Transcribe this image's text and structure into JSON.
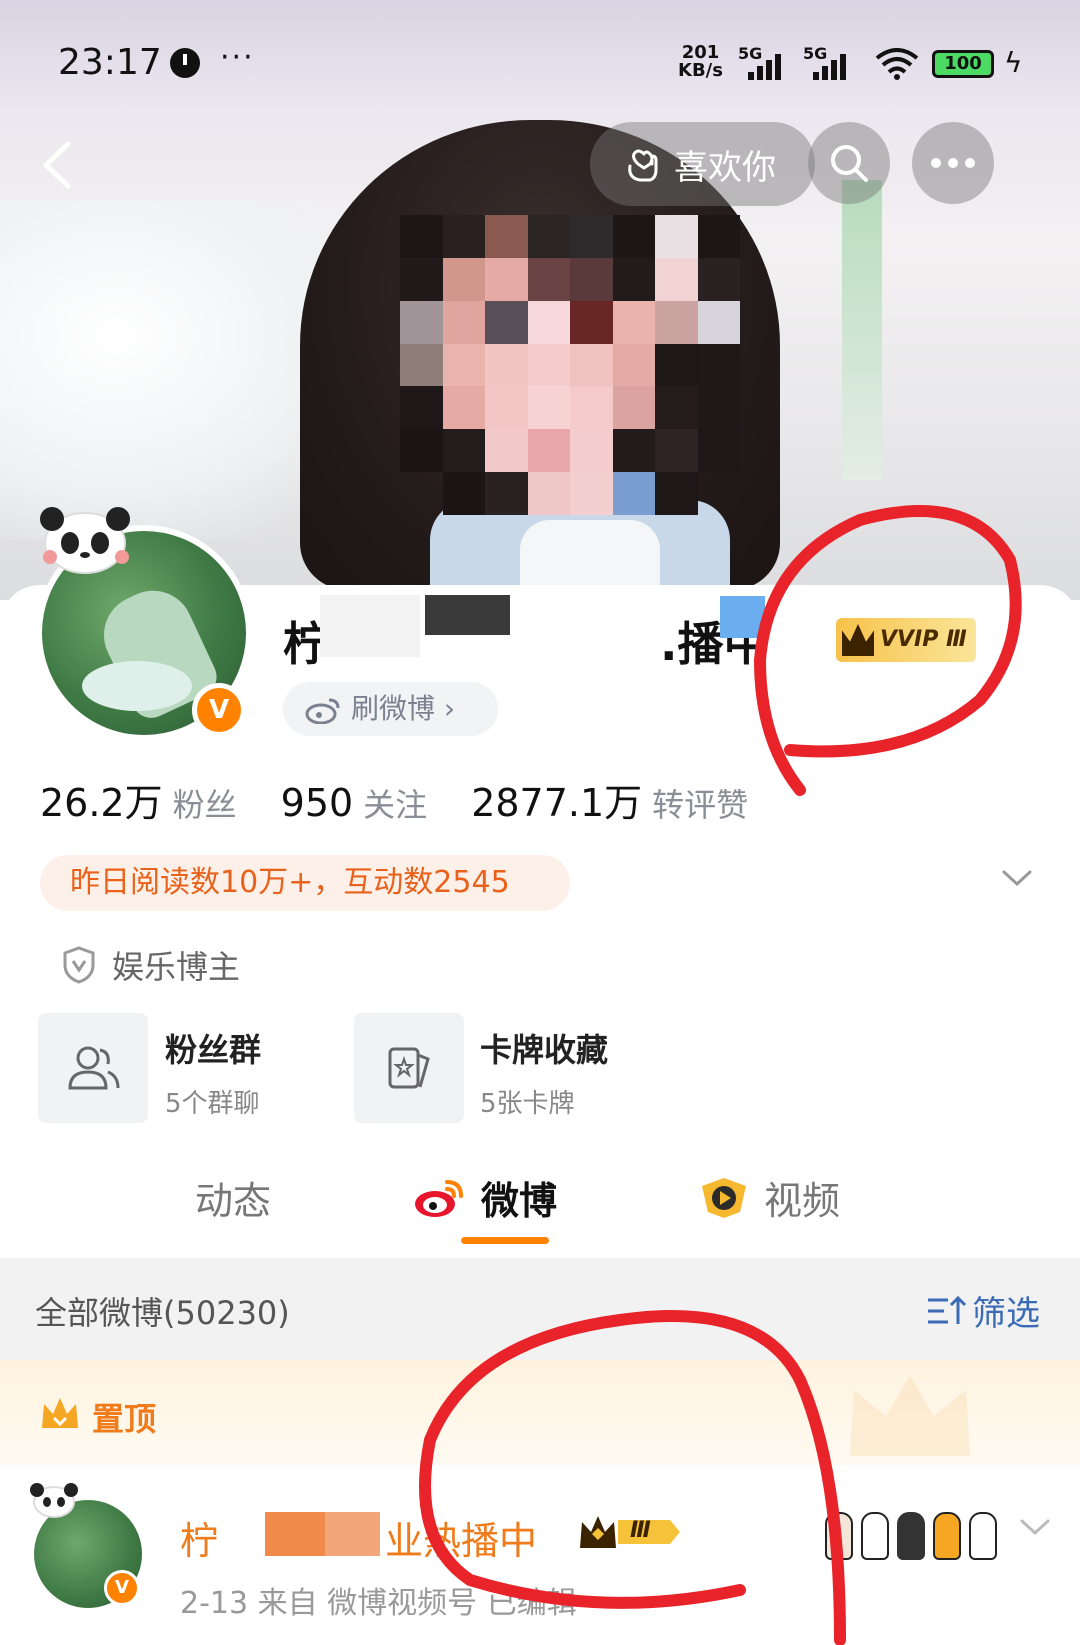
{
  "status_bar": {
    "time": "23:17",
    "more": "···",
    "net_speed_value": "201",
    "net_speed_unit": "KB/s",
    "signal_1": "5G",
    "signal_2": "5G",
    "battery": "100"
  },
  "nav": {
    "like_label": "喜欢你"
  },
  "profile": {
    "name_part1": "柠",
    "name_part2": ".播中",
    "vvip_badge": "VVIP Ⅲ",
    "verified_mark": "V",
    "shua_label": "刷微博 ›",
    "stats": [
      {
        "value": "26.2万",
        "label": "粉丝"
      },
      {
        "value": "950",
        "label": "关注"
      },
      {
        "value": "2877.1万",
        "label": "转评赞"
      }
    ],
    "read_info": "昨日阅读数10万+，互动数2545",
    "category_tag": "娱乐博主"
  },
  "tiles": [
    {
      "title": "粉丝群",
      "subtitle": "5个群聊",
      "icon": "group-icon"
    },
    {
      "title": "卡牌收藏",
      "subtitle": "5张卡牌",
      "icon": "card-icon"
    }
  ],
  "tabs": [
    {
      "label": "动态"
    },
    {
      "label": "微博"
    },
    {
      "label": "视频"
    }
  ],
  "feed": {
    "all_label": "全部微博(50230)",
    "filter_label": "筛选",
    "pinned_label": "置顶"
  },
  "post": {
    "author_part1": "柠",
    "author_part2": "业热播中",
    "crown_badge": "Ⅲ",
    "verified_mark": "V",
    "meta": "2-13  来自 微博视频号  已编辑"
  },
  "colors": {
    "accent": "#ff8200",
    "link": "#3b6bb5",
    "annotation": "#e8232a"
  }
}
